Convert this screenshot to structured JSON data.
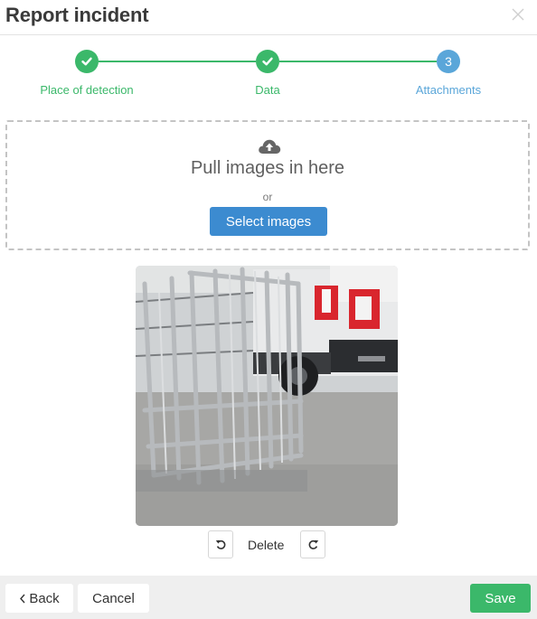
{
  "dialog": {
    "title": "Report incident",
    "close_icon": "close-icon"
  },
  "stepper": {
    "steps": [
      {
        "label": "Place of detection",
        "state": "done",
        "icon": "check-icon"
      },
      {
        "label": "Data",
        "state": "done",
        "icon": "check-icon"
      },
      {
        "label": "Attachments",
        "state": "current",
        "number": "3"
      }
    ],
    "colors": {
      "done": "#3bb86a",
      "current": "#5aa6d9"
    }
  },
  "upload": {
    "icon": "cloud-upload-icon",
    "drop_text": "Pull images in here",
    "or_text": "or",
    "select_label": "Select images",
    "button_color": "#3c8bd0"
  },
  "image_tools": {
    "rotate_left_icon": "rotate-left-icon",
    "delete_label": "Delete",
    "rotate_right_icon": "rotate-right-icon"
  },
  "footer": {
    "back_label": "Back",
    "back_icon": "chevron-left-icon",
    "cancel_label": "Cancel",
    "save_label": "Save",
    "save_color": "#3bb86a"
  }
}
